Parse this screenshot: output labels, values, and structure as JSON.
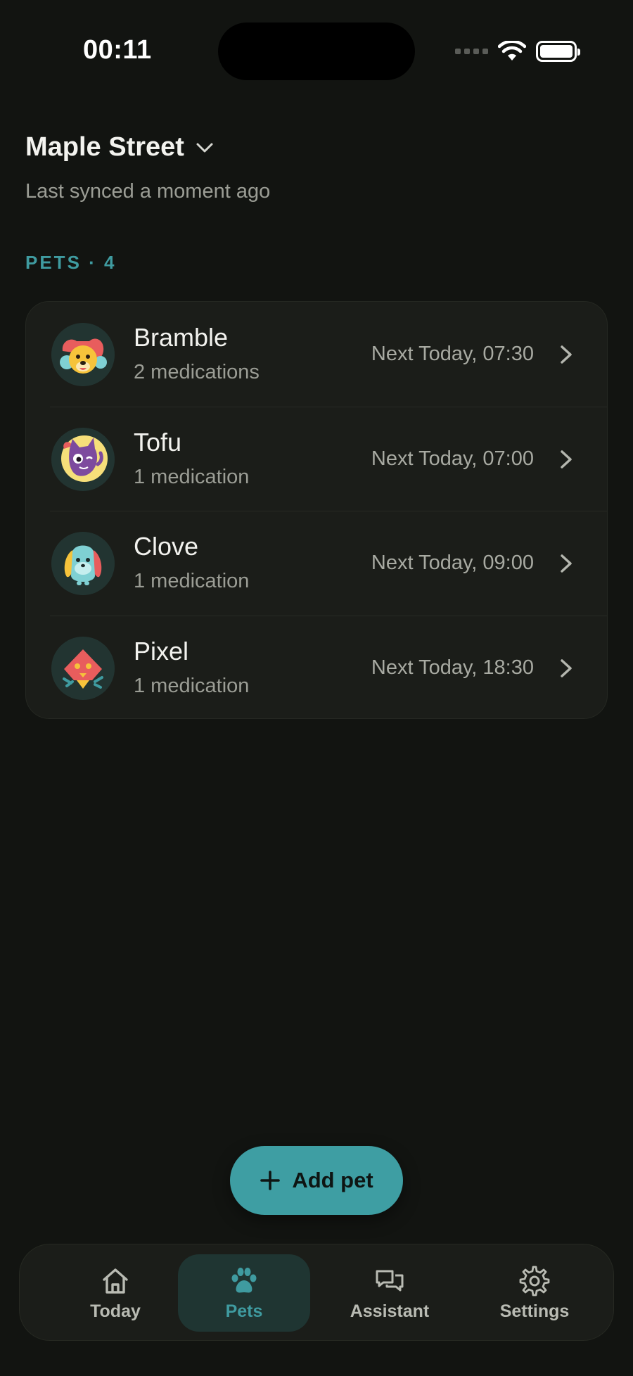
{
  "status_bar": {
    "time": "00:11"
  },
  "header": {
    "location": "Maple Street",
    "sync_status": "Last synced a moment ago"
  },
  "section": {
    "label": "PETS · 4"
  },
  "pets": [
    {
      "name": "Bramble",
      "medications": "2 medications",
      "next": "Next Today, 07:30",
      "avatar_icon": "dog-avatar-icon"
    },
    {
      "name": "Tofu",
      "medications": "1 medication",
      "next": "Next Today, 07:00",
      "avatar_icon": "cat-avatar-icon"
    },
    {
      "name": "Clove",
      "medications": "1 medication",
      "next": "Next Today, 09:00",
      "avatar_icon": "rabbit-avatar-icon"
    },
    {
      "name": "Pixel",
      "medications": "1 medication",
      "next": "Next Today, 18:30",
      "avatar_icon": "bird-avatar-icon"
    }
  ],
  "actions": {
    "add_pet": "Add pet"
  },
  "tabs": [
    {
      "label": "Today",
      "icon": "home-icon",
      "active": false
    },
    {
      "label": "Pets",
      "icon": "paw-icon",
      "active": true
    },
    {
      "label": "Assistant",
      "icon": "chat-icon",
      "active": false
    },
    {
      "label": "Settings",
      "icon": "gear-icon",
      "active": false
    }
  ],
  "colors": {
    "background": "#121411",
    "card": "#1b1d19",
    "accent": "#3f9ba0",
    "active_tab_bg": "#1f3532",
    "primary_text": "#f2f2ee",
    "secondary_text": "#9b9d95"
  }
}
